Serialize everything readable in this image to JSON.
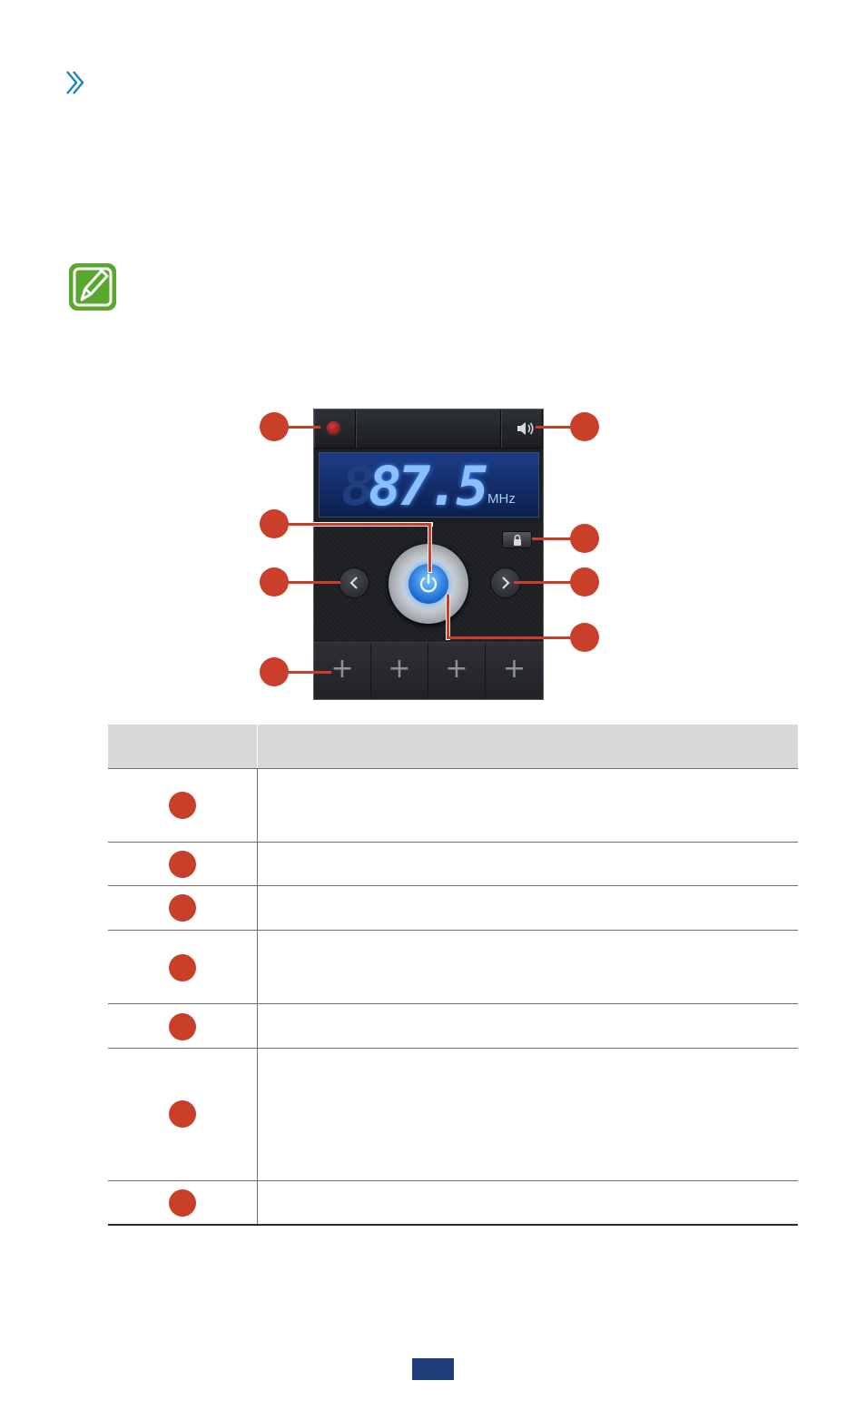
{
  "header": {
    "chevron_icon": "chevron-right-icon",
    "color": "#1a84c7"
  },
  "note": {
    "icon": "note-pencil-icon",
    "color": "#5aa72e"
  },
  "radio": {
    "frequency": "87.5",
    "ghost_digits": "88",
    "unit": "MHz",
    "icons": [
      "record-icon",
      "speaker-icon",
      "lock-icon",
      "prev-icon",
      "next-icon",
      "power-icon"
    ],
    "presets": [
      "+",
      "+",
      "+",
      "+"
    ]
  },
  "callout_color": "#c93f2a",
  "table": {
    "rows": 7
  },
  "page_tab_color": "#1f3d7a"
}
